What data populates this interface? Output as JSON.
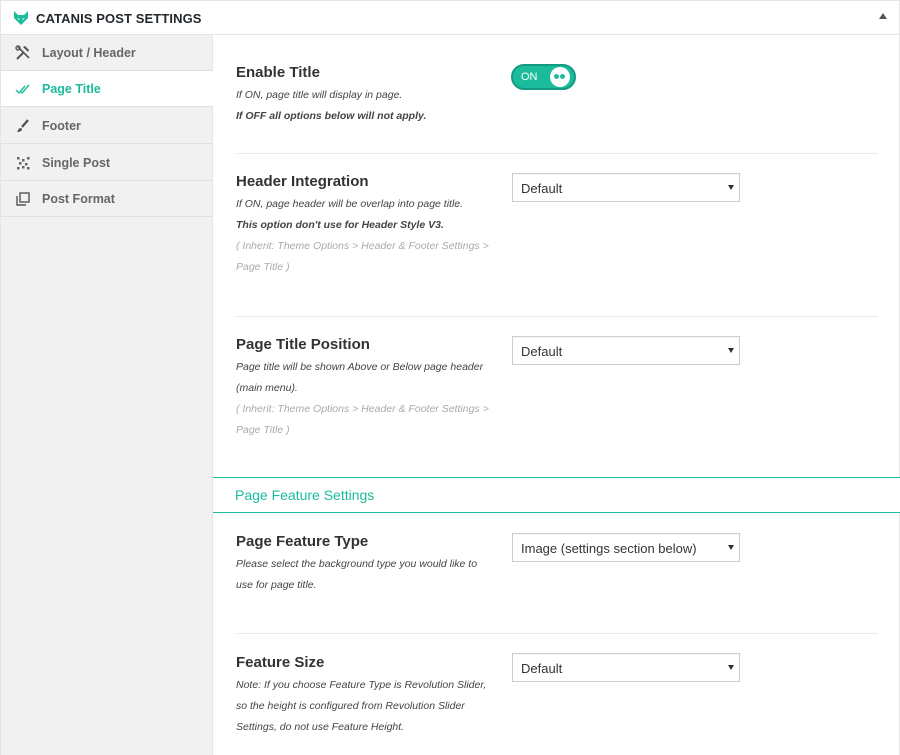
{
  "header": {
    "title": "CATANIS POST SETTINGS",
    "collapse_icon": "triangle-up-icon"
  },
  "colors": {
    "accent": "#1abc9c",
    "accent_border": "#139a80",
    "sidebar_bg": "#f1f1f1"
  },
  "sidebar": {
    "items": [
      {
        "label": "Layout / Header",
        "icon": "tools-icon",
        "active": false
      },
      {
        "label": "Page Title",
        "icon": "checkmarks-icon",
        "active": true
      },
      {
        "label": "Footer",
        "icon": "brush-icon",
        "active": false
      },
      {
        "label": "Single Post",
        "icon": "dots-grid-icon",
        "active": false
      },
      {
        "label": "Post Format",
        "icon": "copy-icon",
        "active": false
      }
    ]
  },
  "fields": {
    "enable_title": {
      "title": "Enable Title",
      "desc1": "If ON, page title will display in page.",
      "desc2": "If OFF all options below will not apply.",
      "toggle_label": "ON"
    },
    "header_integration": {
      "title": "Header Integration",
      "desc1": "If ON, page header will be overlap into page title.",
      "desc2": "This option don't use for Header Style V3.",
      "desc3": "( Inherit: Theme Options > Header & Footer Settings >",
      "desc4": "Page Title )",
      "value": "Default"
    },
    "page_title_position": {
      "title": "Page Title Position",
      "desc1": "Page title will be shown Above or Below page header",
      "desc2": "(main menu).",
      "desc3": "( Inherit: Theme Options > Header & Footer Settings >",
      "desc4": "Page Title )",
      "value": "Default"
    },
    "section": {
      "title": "Page Feature Settings"
    },
    "page_feature_type": {
      "title": "Page Feature Type",
      "desc1": "Please select the background type you would like to",
      "desc2": "use for page title.",
      "value": "Image (settings section below)"
    },
    "feature_size": {
      "title": "Feature Size",
      "desc1": "Note: If you choose Feature Type is Revolution Slider,",
      "desc2": "so the height is configured from Revolution Slider",
      "desc3": "Settings, do not use Feature Height.",
      "value": "Default"
    }
  }
}
